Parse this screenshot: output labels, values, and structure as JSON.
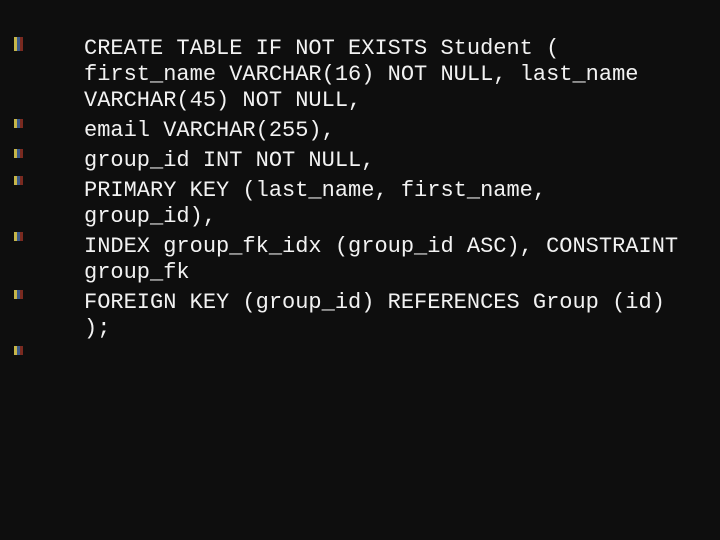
{
  "slide": {
    "code_lines": [
      "CREATE TABLE IF NOT EXISTS Student ( first_name VARCHAR(16) NOT NULL, last_name VARCHAR(45) NOT NULL,",
      "email VARCHAR(255),",
      "group_id INT NOT NULL,",
      "PRIMARY KEY (last_name, first_name, group_id),",
      "INDEX group_fk_idx (group_id ASC), CONSTRAINT group_fk",
      "FOREIGN KEY (group_id) REFERENCES Group (id) );"
    ]
  },
  "gutter_markers": {
    "positions": [
      37,
      42,
      119,
      149,
      176,
      232,
      290,
      346
    ]
  }
}
